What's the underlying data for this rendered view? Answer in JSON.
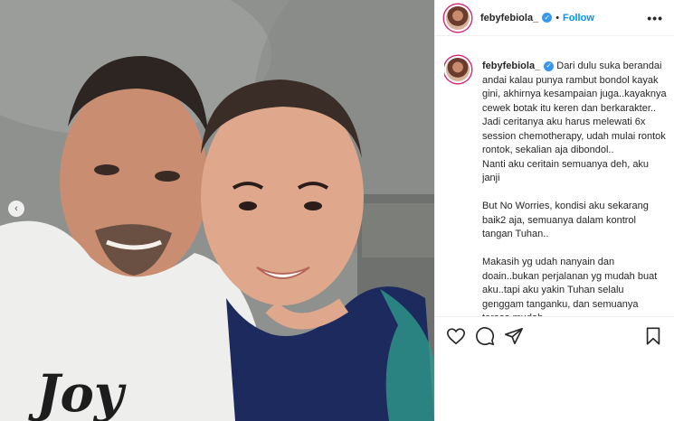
{
  "post": {
    "username": "febyfebiola_",
    "follow_label": "Follow",
    "dot": "•",
    "more_label": "•••",
    "verified_mark": "✓",
    "carousel_prev": "‹"
  },
  "caption": {
    "username": "febyfebiola_",
    "text": " Dari dulu suka berandai andai kalau punya rambut bondol kayak gini, akhirnya kesampaian juga..kayaknya cewek botak itu keren dan berkarakter..\nJadi ceritanya aku harus melewati 6x session chemotherapy, udah mulai rontok rontok, sekalian aja dibondol..\nNanti aku ceritain semuanya deh, aku janji\n\nBut No Worries, kondisi aku sekarang baik2 aja, semuanya dalam kontrol tangan Tuhan..\n\nMakasih yg udah nanyain dan doain..bukan perjalanan yg mudah buat aku..tapi aku yakin Tuhan selalu genggam tanganku, dan semuanya terasa mudah.."
  },
  "photo": {
    "shirt_text": "Joy"
  },
  "icons": {
    "like": "heart-icon",
    "comment": "comment-icon",
    "share": "share-icon",
    "save": "bookmark-icon"
  },
  "colors": {
    "follow": "#0095f6",
    "verified": "#3897f0",
    "text": "#262626"
  }
}
